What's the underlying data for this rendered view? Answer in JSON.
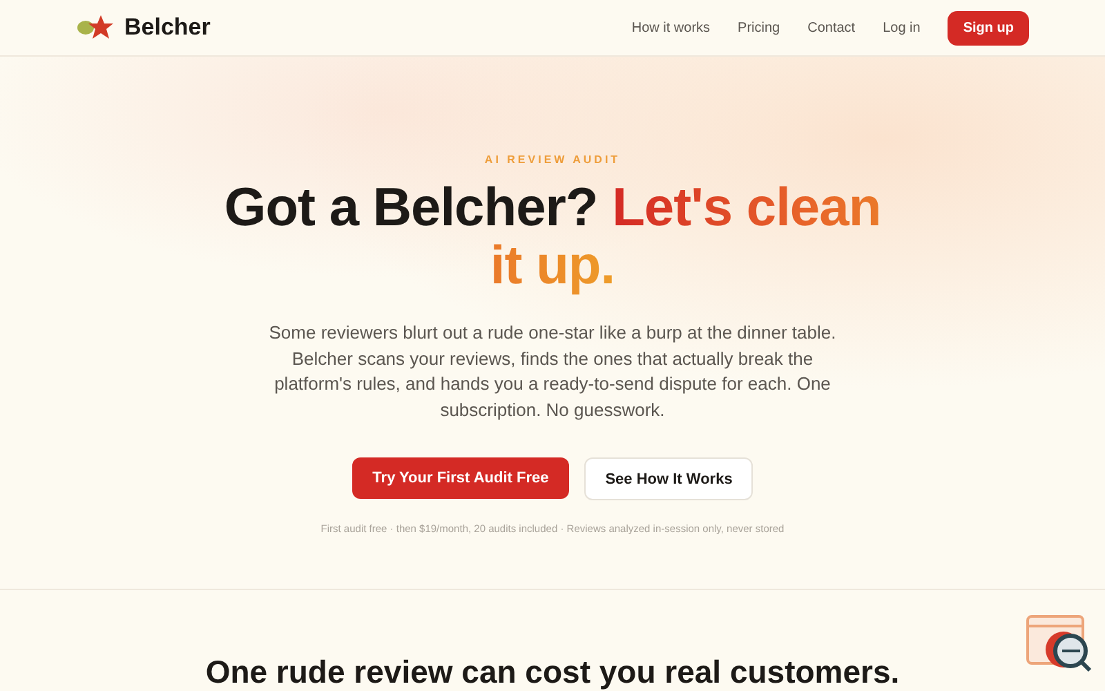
{
  "nav": {
    "brand": "Belcher",
    "links": [
      "How it works",
      "Pricing",
      "Contact",
      "Log in"
    ],
    "signup": "Sign up"
  },
  "hero": {
    "eyebrow": "AI REVIEW AUDIT",
    "headline": "Got a Belcher?",
    "headline_accent": "Let's clean it up.",
    "body": "Some reviewers blurt out a rude one-star like a burp at the dinner table. Belcher scans your reviews, finds the ones that actually break the platform's rules, and hands you a ready-to-send dispute for each. One subscription. No guesswork.",
    "primary_button": "Try Your First Audit Free",
    "secondary_button": "See How It Works",
    "fine_print": "First audit free · then $19/month, 20 audits included · Reviews analyzed in-session only, never stored"
  },
  "section": {
    "heading": "One rude review can cost you real customers."
  }
}
